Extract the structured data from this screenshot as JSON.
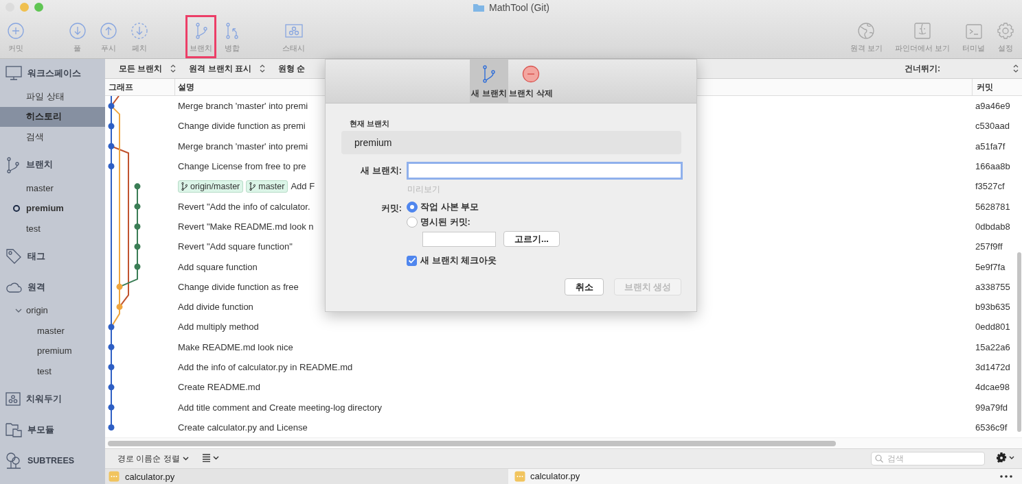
{
  "window": {
    "title": "MathTool (Git)"
  },
  "toolbar": {
    "groups": [
      [
        {
          "label": "커밋",
          "kind": "commit",
          "highlighted": false
        }
      ],
      [
        {
          "label": "풀",
          "kind": "pull",
          "highlighted": false
        },
        {
          "label": "푸시",
          "kind": "push",
          "highlighted": false
        },
        {
          "label": "페치",
          "kind": "fetch",
          "highlighted": false
        }
      ],
      [
        {
          "label": "브랜치",
          "kind": "branch",
          "highlighted": true
        },
        {
          "label": "병합",
          "kind": "merge",
          "highlighted": false
        }
      ],
      [
        {
          "label": "스태시",
          "kind": "stash",
          "highlighted": false
        }
      ]
    ],
    "right": [
      {
        "label": "원격 보기",
        "kind": "remote"
      },
      {
        "label": "파인더에서 보기",
        "kind": "finder"
      },
      {
        "label": "터미널",
        "kind": "terminal"
      },
      {
        "label": "설정",
        "kind": "settings"
      }
    ]
  },
  "sidebar": {
    "sections": [
      {
        "kind": "workspace",
        "label": "워크스페이스",
        "items": [
          {
            "label": "파일 상태",
            "selected": false
          },
          {
            "label": "히스토리",
            "selected": true
          },
          {
            "label": "검색",
            "selected": false
          }
        ]
      },
      {
        "kind": "branches",
        "label": "브랜치",
        "items": [
          {
            "label": "master",
            "current": false
          },
          {
            "label": "premium",
            "current": true
          },
          {
            "label": "test",
            "current": false
          }
        ]
      },
      {
        "kind": "tags",
        "label": "태그"
      },
      {
        "kind": "remotes",
        "label": "원격",
        "items": [
          {
            "label": "origin",
            "expanded": true,
            "children": [
              {
                "label": "master"
              },
              {
                "label": "premium"
              },
              {
                "label": "test"
              }
            ]
          }
        ]
      },
      {
        "kind": "stashes",
        "label": "치워두기"
      },
      {
        "kind": "submodules",
        "label": "부모듈"
      },
      {
        "kind": "subtrees",
        "label": "SUBTREES"
      }
    ]
  },
  "filters": [
    {
      "label": "모든 브랜치",
      "chevron": true
    },
    {
      "label": "원격 브랜치 표시",
      "chevron": true
    },
    {
      "label": "원형 순",
      "chevron": false
    }
  ],
  "jump": {
    "label": "건너뛰기:"
  },
  "columns": [
    {
      "label": "그래프"
    },
    {
      "label": "설명"
    },
    {
      "label": "커밋"
    }
  ],
  "rows": [
    {
      "desc": "Merge branch 'master' into premi",
      "hash": "a9a46e9"
    },
    {
      "desc": "Change divide function as premi",
      "hash": "c530aad"
    },
    {
      "desc": "Merge branch 'master' into premi",
      "hash": "a51fa7f"
    },
    {
      "desc": "Change License from free to pre",
      "hash": "166aa8b"
    },
    {
      "desc": "Add F",
      "hash": "f3527cf",
      "refs": [
        {
          "label": "origin/master"
        },
        {
          "label": "master"
        }
      ]
    },
    {
      "desc": "Revert \"Add the info of calculator.",
      "hash": "5628781"
    },
    {
      "desc": "Revert \"Make README.md look n",
      "hash": "0dbdab8"
    },
    {
      "desc": "Revert \"Add square function\"",
      "hash": "257f9ff"
    },
    {
      "desc": "Add square function",
      "hash": "5e9f7fa"
    },
    {
      "desc": "Change divide function as free",
      "hash": "a338755"
    },
    {
      "desc": "Add divide function",
      "hash": "b93b635"
    },
    {
      "desc": "Add multiply method",
      "hash": "0edd801"
    },
    {
      "desc": "Make README.md look nice",
      "hash": "15a22a6"
    },
    {
      "desc": "Add the info of calculator.py in README.md",
      "hash": "3d1472d"
    },
    {
      "desc": "Create README.md",
      "hash": "4dcae98"
    },
    {
      "desc": "Add title comment and Create meeting-log directory",
      "hash": "99a79fd"
    },
    {
      "desc": "Create calculator.py and License",
      "hash": "6536c9f"
    }
  ],
  "bottom": {
    "sort": "경로 이름순 정렬",
    "search_placeholder": "검색"
  },
  "files": {
    "left": "calculator.py",
    "right": "calculator.py"
  },
  "dialog": {
    "tabs": [
      {
        "label": "새 브랜치",
        "kind": "new",
        "selected": true
      },
      {
        "label": "브랜치 삭제",
        "kind": "delete",
        "selected": false
      }
    ],
    "current_label": "현재 브랜치",
    "current_value": "premium",
    "new_branch": {
      "label": "새 브랜치:",
      "focused": true
    },
    "preview": "미리보기",
    "commit_label": "커밋:",
    "commit_options": [
      {
        "label": "작업 사본 부모",
        "selected": true
      },
      {
        "label": "명시된 커밋:",
        "selected": false
      }
    ],
    "pick_button": "고르기...",
    "checkout": {
      "label": "새 브랜치 체크아웃",
      "checked": true
    },
    "buttons": [
      {
        "label": "취소",
        "disabled": false
      },
      {
        "label": "브랜치 생성",
        "disabled": true
      }
    ]
  }
}
